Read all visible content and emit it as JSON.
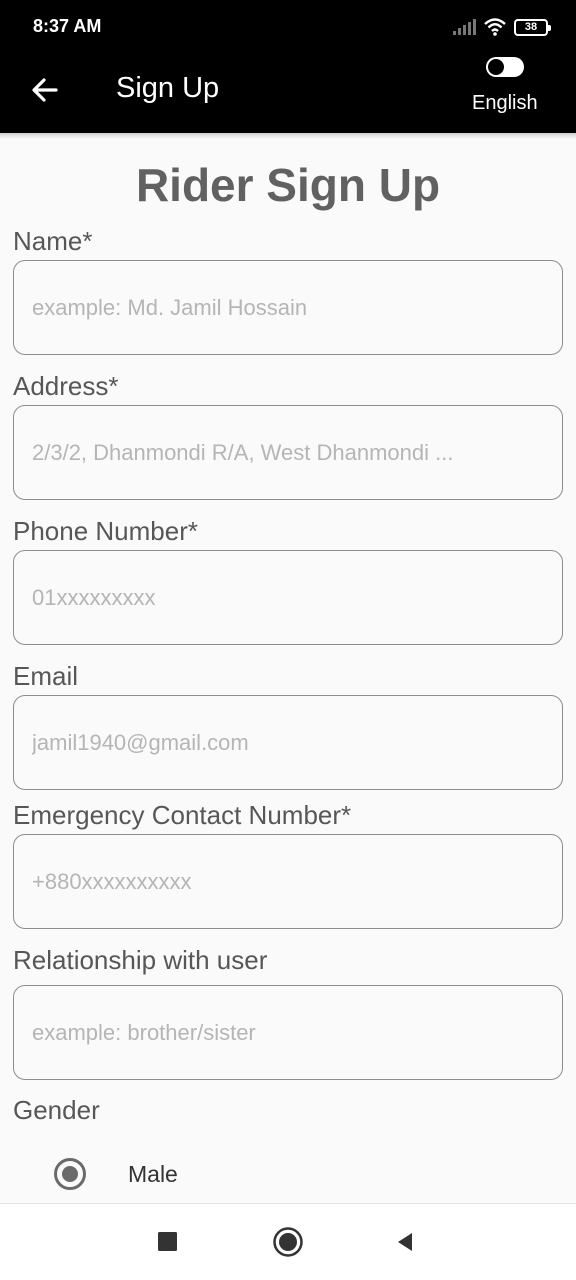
{
  "status_bar": {
    "time": "8:37 AM",
    "battery": "38",
    "icons": [
      "signal-icon",
      "wifi-icon",
      "battery-icon"
    ]
  },
  "app_bar": {
    "title": "Sign Up",
    "back_icon": "arrow-left-icon",
    "language_label": "English",
    "language_toggle_on": true
  },
  "form": {
    "title": "Rider Sign Up",
    "fields": [
      {
        "label": "Name*",
        "value": "",
        "placeholder": "example: Md. Jamil Hossain"
      },
      {
        "label": "Address*",
        "value": "",
        "placeholder": "2/3/2, Dhanmondi R/A, West Dhanmondi ..."
      },
      {
        "label": "Phone Number*",
        "value": "",
        "placeholder": "01xxxxxxxxx"
      },
      {
        "label": "Email",
        "value": "",
        "placeholder": "jamil1940@gmail.com"
      },
      {
        "label": "Emergency Contact Number*",
        "value": "",
        "placeholder": "+880xxxxxxxxxx"
      },
      {
        "label": "Relationship with user",
        "value": "",
        "placeholder": "example: brother/sister"
      }
    ],
    "gender": {
      "label": "Gender",
      "options": [
        {
          "label": "Male",
          "selected": true
        }
      ]
    }
  },
  "nav_bar": {
    "icons": [
      "recent-apps-icon",
      "home-icon",
      "back-triangle-icon"
    ]
  },
  "colors": {
    "app_bar": "#000000",
    "background": "#fafafa",
    "title": "#616161",
    "input_border": "#8d8d8d",
    "placeholder": "#b5b5b5"
  }
}
